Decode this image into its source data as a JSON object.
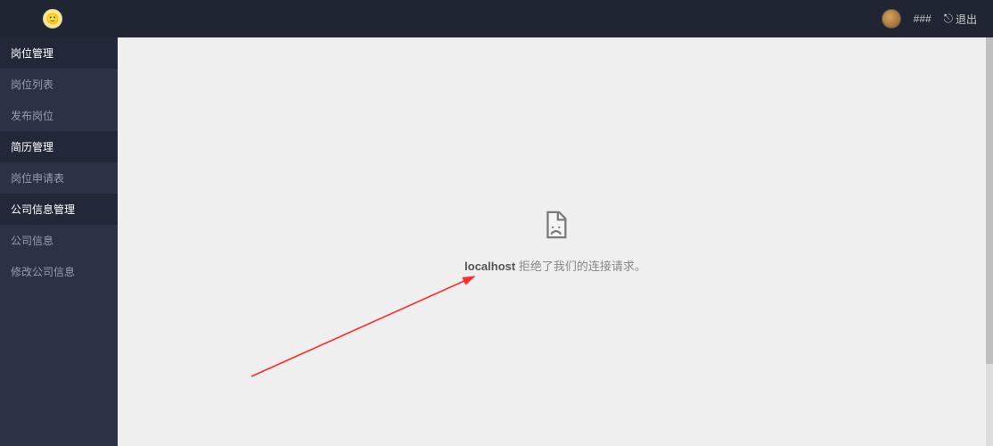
{
  "topbar": {
    "logo_emoji": "🙂",
    "username": "###",
    "logout_label": "退出"
  },
  "sidebar": {
    "groups": [
      {
        "title": "岗位管理",
        "items": [
          "岗位列表",
          "发布岗位"
        ]
      },
      {
        "title": "简历管理",
        "items": [
          "岗位申请表"
        ]
      },
      {
        "title": "公司信息管理",
        "items": [
          "公司信息",
          "修改公司信息"
        ]
      }
    ]
  },
  "main": {
    "error_host": "localhost",
    "error_suffix": " 拒绝了我们的连接请求。"
  },
  "watermark": ""
}
